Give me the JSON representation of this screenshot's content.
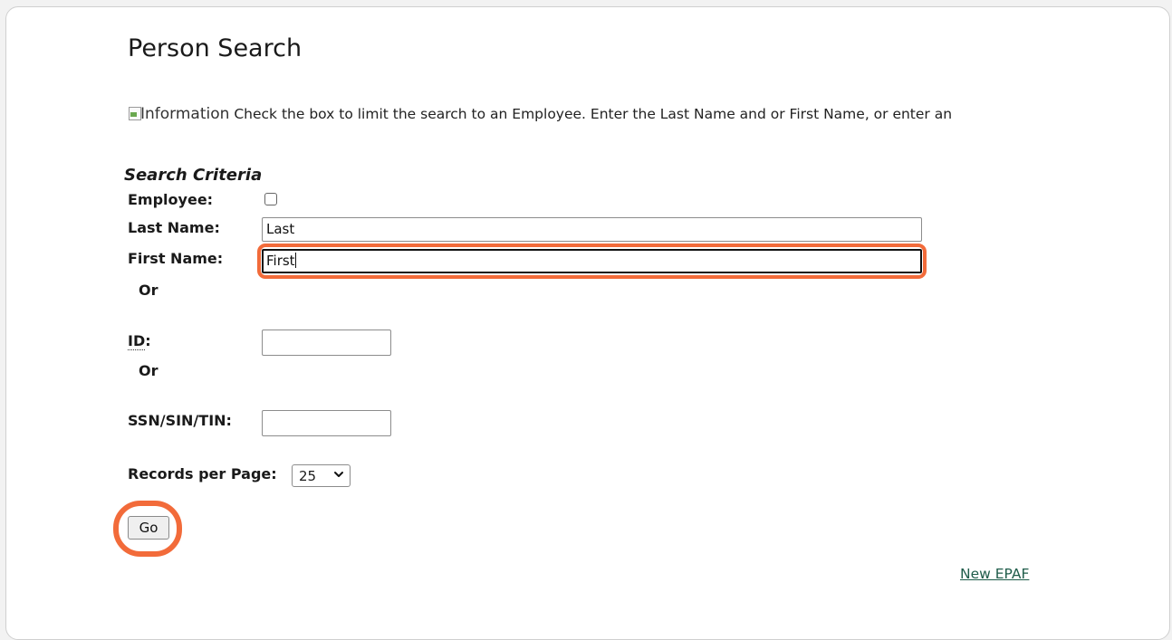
{
  "page": {
    "title": "Person Search",
    "info_image_alt": "Information",
    "info_text": "Check the box to limit the search to an Employee. Enter the Last Name and or First Name, or enter an"
  },
  "search": {
    "section_title": "Search Criteria",
    "employee_label": "Employee:",
    "employee_checked": false,
    "last_name_label": "Last Name:",
    "last_name_value": "Last",
    "first_name_label": "First Name:",
    "first_name_value": "First",
    "or_label_1": "Or",
    "id_label": "ID",
    "id_colon": ":",
    "id_value": "",
    "or_label_2": "Or",
    "ssn_label": "SSN/SIN/TIN:",
    "ssn_value": "",
    "records_label": "Records per Page:",
    "records_value": "25",
    "go_label": "Go"
  },
  "footer": {
    "new_epaf_label": "New EPAF"
  },
  "colors": {
    "highlight": "#f26b3a",
    "link": "#1f5c4a"
  }
}
